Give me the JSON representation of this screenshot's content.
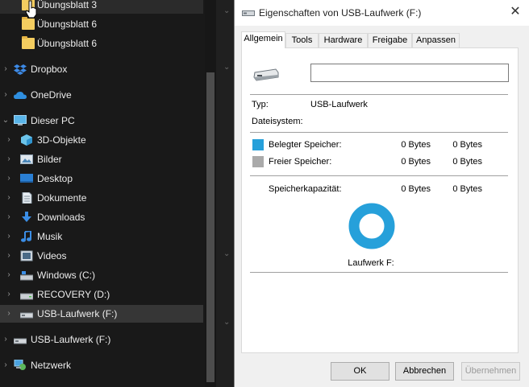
{
  "explorer": {
    "items": [
      {
        "label": "Übungsblatt 3",
        "icon": "folder-icon"
      },
      {
        "label": "Übungsblatt 6",
        "icon": "folder-icon"
      },
      {
        "label": "Übungsblatt 6",
        "icon": "folder-icon"
      },
      {
        "label": "Dropbox",
        "icon": "dropbox-icon"
      },
      {
        "label": "OneDrive",
        "icon": "onedrive-icon"
      },
      {
        "label": "Dieser PC",
        "icon": "this-pc-icon"
      },
      {
        "label": "3D-Objekte",
        "icon": "3d-objects-icon"
      },
      {
        "label": "Bilder",
        "icon": "pictures-icon"
      },
      {
        "label": "Desktop",
        "icon": "desktop-icon"
      },
      {
        "label": "Dokumente",
        "icon": "documents-icon"
      },
      {
        "label": "Downloads",
        "icon": "downloads-icon"
      },
      {
        "label": "Musik",
        "icon": "music-icon"
      },
      {
        "label": "Videos",
        "icon": "videos-icon"
      },
      {
        "label": "Windows (C:)",
        "icon": "drive-c-icon"
      },
      {
        "label": "RECOVERY (D:)",
        "icon": "drive-d-icon"
      },
      {
        "label": "USB-Laufwerk (F:)",
        "icon": "usb-drive-icon"
      },
      {
        "label": "USB-Laufwerk (F:)",
        "icon": "usb-drive-icon"
      },
      {
        "label": "Netzwerk",
        "icon": "network-icon"
      }
    ]
  },
  "dialog": {
    "title": "Eigenschaften von USB-Laufwerk (F:)",
    "tabs": [
      "Allgemein",
      "Tools",
      "Hardware",
      "Freigabe",
      "Anpassen"
    ],
    "name_value": "",
    "type_label": "Typ:",
    "type_value": "USB-Laufwerk",
    "fs_label": "Dateisystem:",
    "fs_value": "",
    "used_label": "Belegter Speicher:",
    "used_bytes": "0 Bytes",
    "used_size": "0 Bytes",
    "free_label": "Freier Speicher:",
    "free_bytes": "0 Bytes",
    "free_size": "0 Bytes",
    "capacity_label": "Speicherkapazität:",
    "capacity_bytes": "0 Bytes",
    "capacity_size": "0 Bytes",
    "drive_label": "Laufwerk F:",
    "buttons": {
      "ok": "OK",
      "cancel": "Abbrechen",
      "apply": "Übernehmen"
    }
  },
  "colors": {
    "used": "#26a0da",
    "free": "#aaaaaa",
    "ring": "#26a0da",
    "selection": "#363636"
  }
}
